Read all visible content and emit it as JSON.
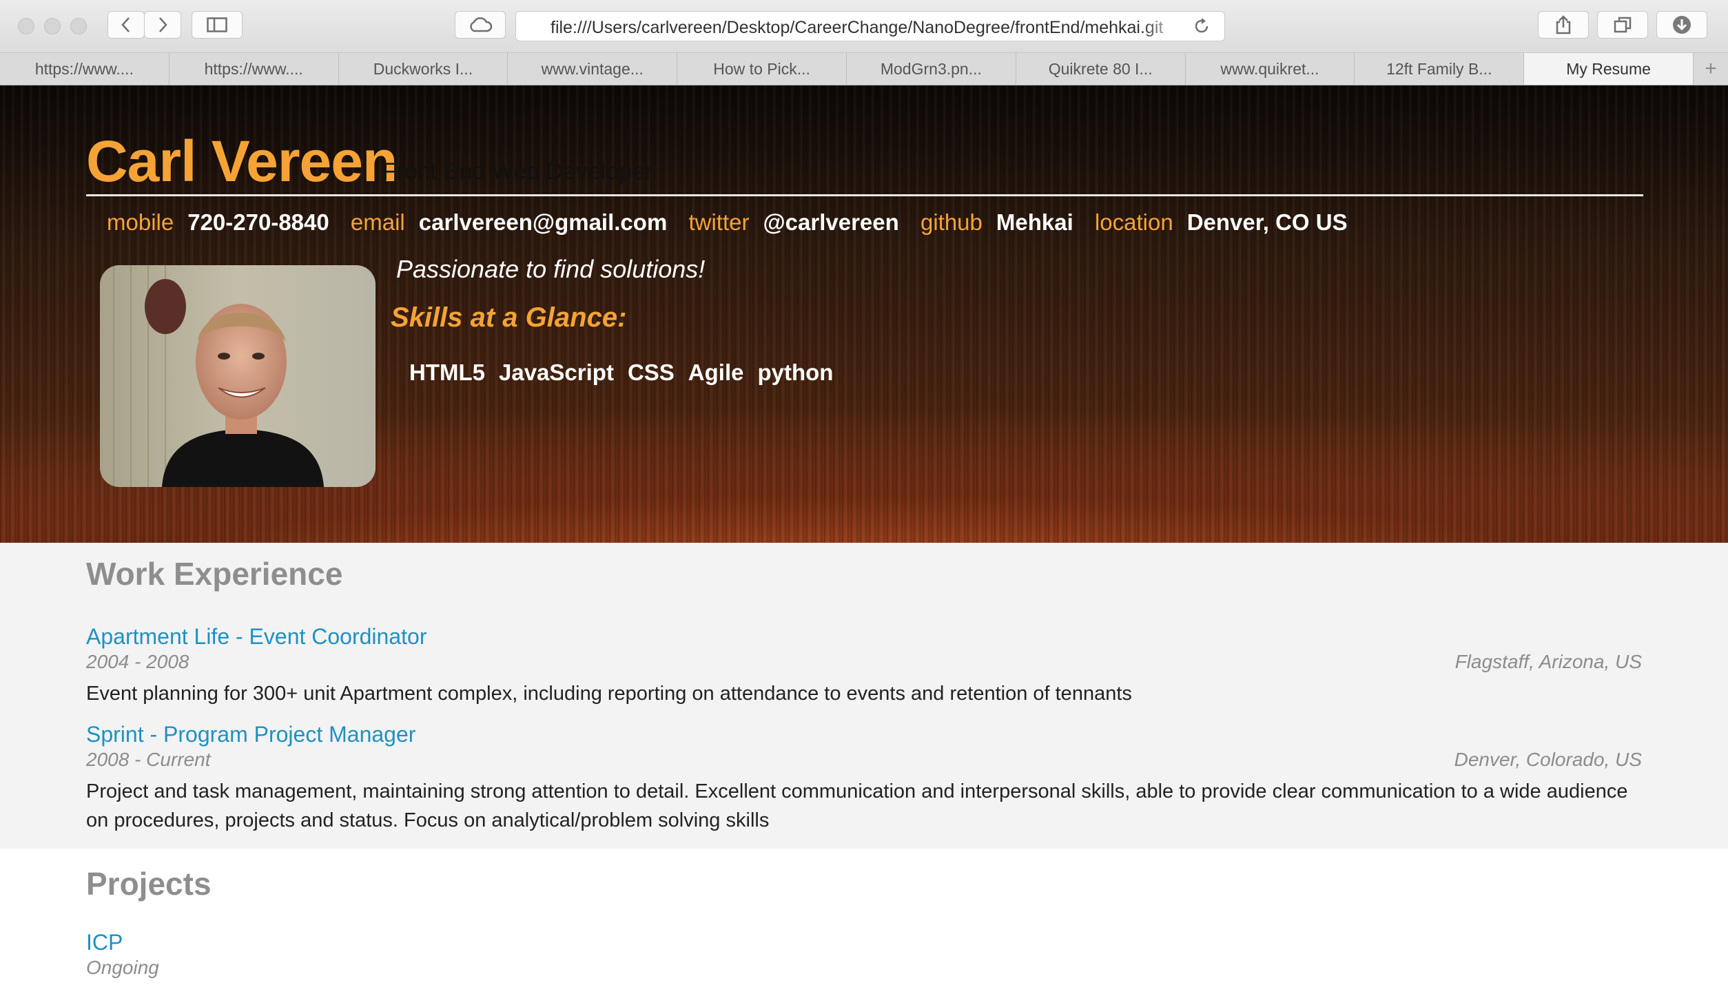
{
  "browser": {
    "url": "file:///Users/carlvereen/Desktop/CareerChange/NanoDegree/frontEnd/mehkai.git",
    "tabs": [
      {
        "label": "https://www...."
      },
      {
        "label": "https://www...."
      },
      {
        "label": "Duckworks I..."
      },
      {
        "label": "www.vintage..."
      },
      {
        "label": "How to Pick..."
      },
      {
        "label": "ModGrn3.pn..."
      },
      {
        "label": "Quikrete 80 I..."
      },
      {
        "label": "www.quikret..."
      },
      {
        "label": "12ft Family B..."
      },
      {
        "label": "My Resume"
      }
    ],
    "new_tab_icon": "+"
  },
  "header": {
    "name": "Carl Vereen",
    "role": "Front End Web Developer",
    "contacts": {
      "mobile_label": "mobile",
      "mobile": "720-270-8840",
      "email_label": "email",
      "email": "carlvereen@gmail.com",
      "twitter_label": "twitter",
      "twitter": "@carlvereen",
      "github_label": "github",
      "github": "Mehkai",
      "location_label": "location",
      "location": "Denver, CO US"
    },
    "welcome": "Passionate to find solutions!",
    "skills_title": "Skills at a Glance:",
    "skills": [
      "HTML5",
      "JavaScript",
      "CSS",
      "Agile",
      "python"
    ],
    "accent_color": "#f5a336"
  },
  "work": {
    "title": "Work Experience",
    "jobs": [
      {
        "title": "Apartment Life - Event Coordinator",
        "dates": "2004 - 2008",
        "location": "Flagstaff, Arizona, US",
        "description": "Event planning for 300+ unit Apartment complex, including reporting on attendance to events and retention of tennants"
      },
      {
        "title": "Sprint - Program Project Manager",
        "dates": "2008 - Current",
        "location": "Denver, Colorado, US",
        "description": "Project and task management, maintaining strong attention to detail. Excellent communication and interpersonal skills, able to provide clear communication to a wide audience on procedures, projects and status. Focus on analytical/problem solving skills"
      }
    ]
  },
  "projects": {
    "title": "Projects",
    "items": [
      {
        "title": "ICP",
        "dates": "Ongoing"
      }
    ]
  }
}
